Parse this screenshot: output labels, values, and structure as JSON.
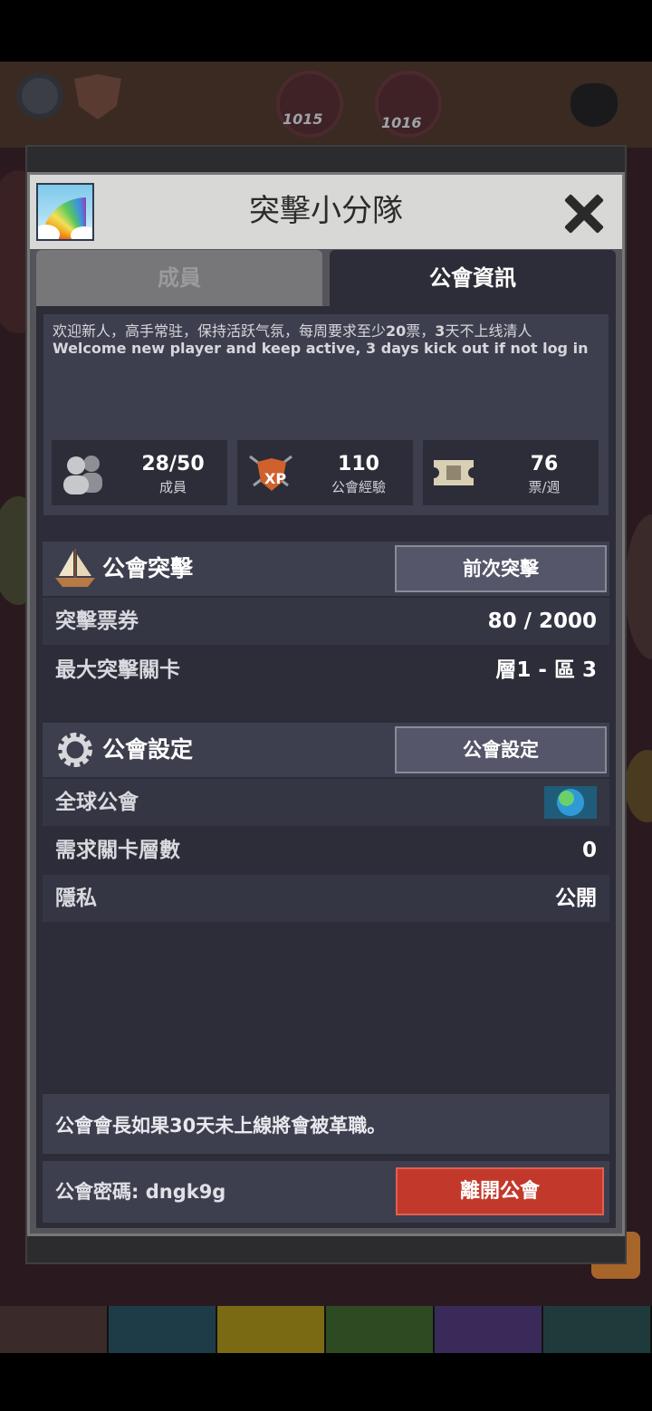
{
  "dialog": {
    "title": "突擊小分隊",
    "tabs": [
      {
        "label": "成員",
        "active": false
      },
      {
        "label": "公會資訊",
        "active": true
      }
    ]
  },
  "background": {
    "orb_numbers": [
      "1015",
      "1016"
    ]
  },
  "notice": {
    "line_cn_pre": "欢迎新人，高手常驻，保持活跃气氛，每周要求至少",
    "line_cn_num": "20",
    "line_cn_mid": "票，",
    "line_cn_num2": "3",
    "line_cn_post": "天不上线清人",
    "line_en": "Welcome new player and keep active, 3 days kick out if not log in"
  },
  "stats": [
    {
      "value": "28/50",
      "label": "成員",
      "icon": "members-icon"
    },
    {
      "value": "110",
      "label": "公會經驗",
      "icon": "xp-shield-icon"
    },
    {
      "value": "76",
      "label": "票/週",
      "icon": "ticket-icon"
    }
  ],
  "raid": {
    "title": "公會突擊",
    "button": "前次突擊",
    "rows": [
      {
        "key": "突擊票券",
        "value": "80 / 2000"
      },
      {
        "key": "最大突擊關卡",
        "value": "層1 - 區 3"
      }
    ]
  },
  "settings": {
    "title": "公會設定",
    "button": "公會設定",
    "rows": [
      {
        "key": "全球公會",
        "value": ""
      },
      {
        "key": "需求關卡層數",
        "value": "0"
      },
      {
        "key": "隱私",
        "value": "公開"
      }
    ]
  },
  "footer": {
    "warning": "公會會長如果30天未上線將會被革職。",
    "password": "公會密碼: dngk9g",
    "leave_button": "離開公會",
    "help": "?"
  },
  "colors": {
    "panel": "#2c2d38",
    "row_alt": "#353644",
    "leave": "#c2392b",
    "bottom_tabs": [
      "#3b2a2a",
      "#1e3c48",
      "#7a6a14",
      "#2e4a22",
      "#3a2a5a",
      "#1f3a3a"
    ]
  }
}
